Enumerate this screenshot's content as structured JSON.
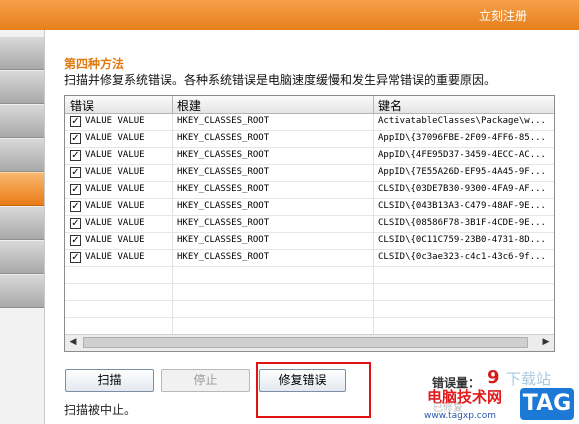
{
  "topbar": {
    "register_label": "立刻注册"
  },
  "sidebar": {
    "active_index": 6
  },
  "method": {
    "title": "第四种方法",
    "description": "扫描并修复系统错误。各种系统错误是电脑速度缓慢和发生异常错误的重要原因。"
  },
  "table": {
    "columns": [
      "错误",
      "根建",
      "键名"
    ],
    "rows": [
      {
        "checked": true,
        "error": "VALUE VALUE",
        "root": "HKEY_CLASSES_ROOT",
        "key": "ActivatableClasses\\Package\\w..."
      },
      {
        "checked": true,
        "error": "VALUE VALUE",
        "root": "HKEY_CLASSES_ROOT",
        "key": "AppID\\{37096FBE-2F09-4FF6-85..."
      },
      {
        "checked": true,
        "error": "VALUE VALUE",
        "root": "HKEY_CLASSES_ROOT",
        "key": "AppID\\{4FE95D37-3459-4ECC-AC..."
      },
      {
        "checked": true,
        "error": "VALUE VALUE",
        "root": "HKEY_CLASSES_ROOT",
        "key": "AppID\\{7E55A26D-EF95-4A45-9F..."
      },
      {
        "checked": true,
        "error": "VALUE VALUE",
        "root": "HKEY_CLASSES_ROOT",
        "key": "CLSID\\{03DE7B30-9300-4FA9-AF..."
      },
      {
        "checked": true,
        "error": "VALUE VALUE",
        "root": "HKEY_CLASSES_ROOT",
        "key": "CLSID\\{043B13A3-C479-48AF-9E..."
      },
      {
        "checked": true,
        "error": "VALUE VALUE",
        "root": "HKEY_CLASSES_ROOT",
        "key": "CLSID\\{08586F78-3B1F-4CDE-9E..."
      },
      {
        "checked": true,
        "error": "VALUE VALUE",
        "root": "HKEY_CLASSES_ROOT",
        "key": "CLSID\\{0C11C759-23B0-4731-8D..."
      },
      {
        "checked": true,
        "error": "VALUE VALUE",
        "root": "HKEY_CLASSES_ROOT",
        "key": "CLSID\\{0c3ae323-c4c1-43c6-9f..."
      }
    ],
    "check_mark": "✓"
  },
  "buttons": {
    "scan": "扫描",
    "stop": "停止",
    "fix": "修复错误"
  },
  "status": "扫描被中止。",
  "errors": {
    "label": "错误量：",
    "count": "9"
  },
  "watermark": {
    "title": "电脑技术网",
    "overlay": "下载站",
    "under": "已修复",
    "url": "www.tagxp.com",
    "tag": "TAG"
  },
  "icons": {
    "scroll_left": "◀",
    "scroll_right": "▶"
  }
}
